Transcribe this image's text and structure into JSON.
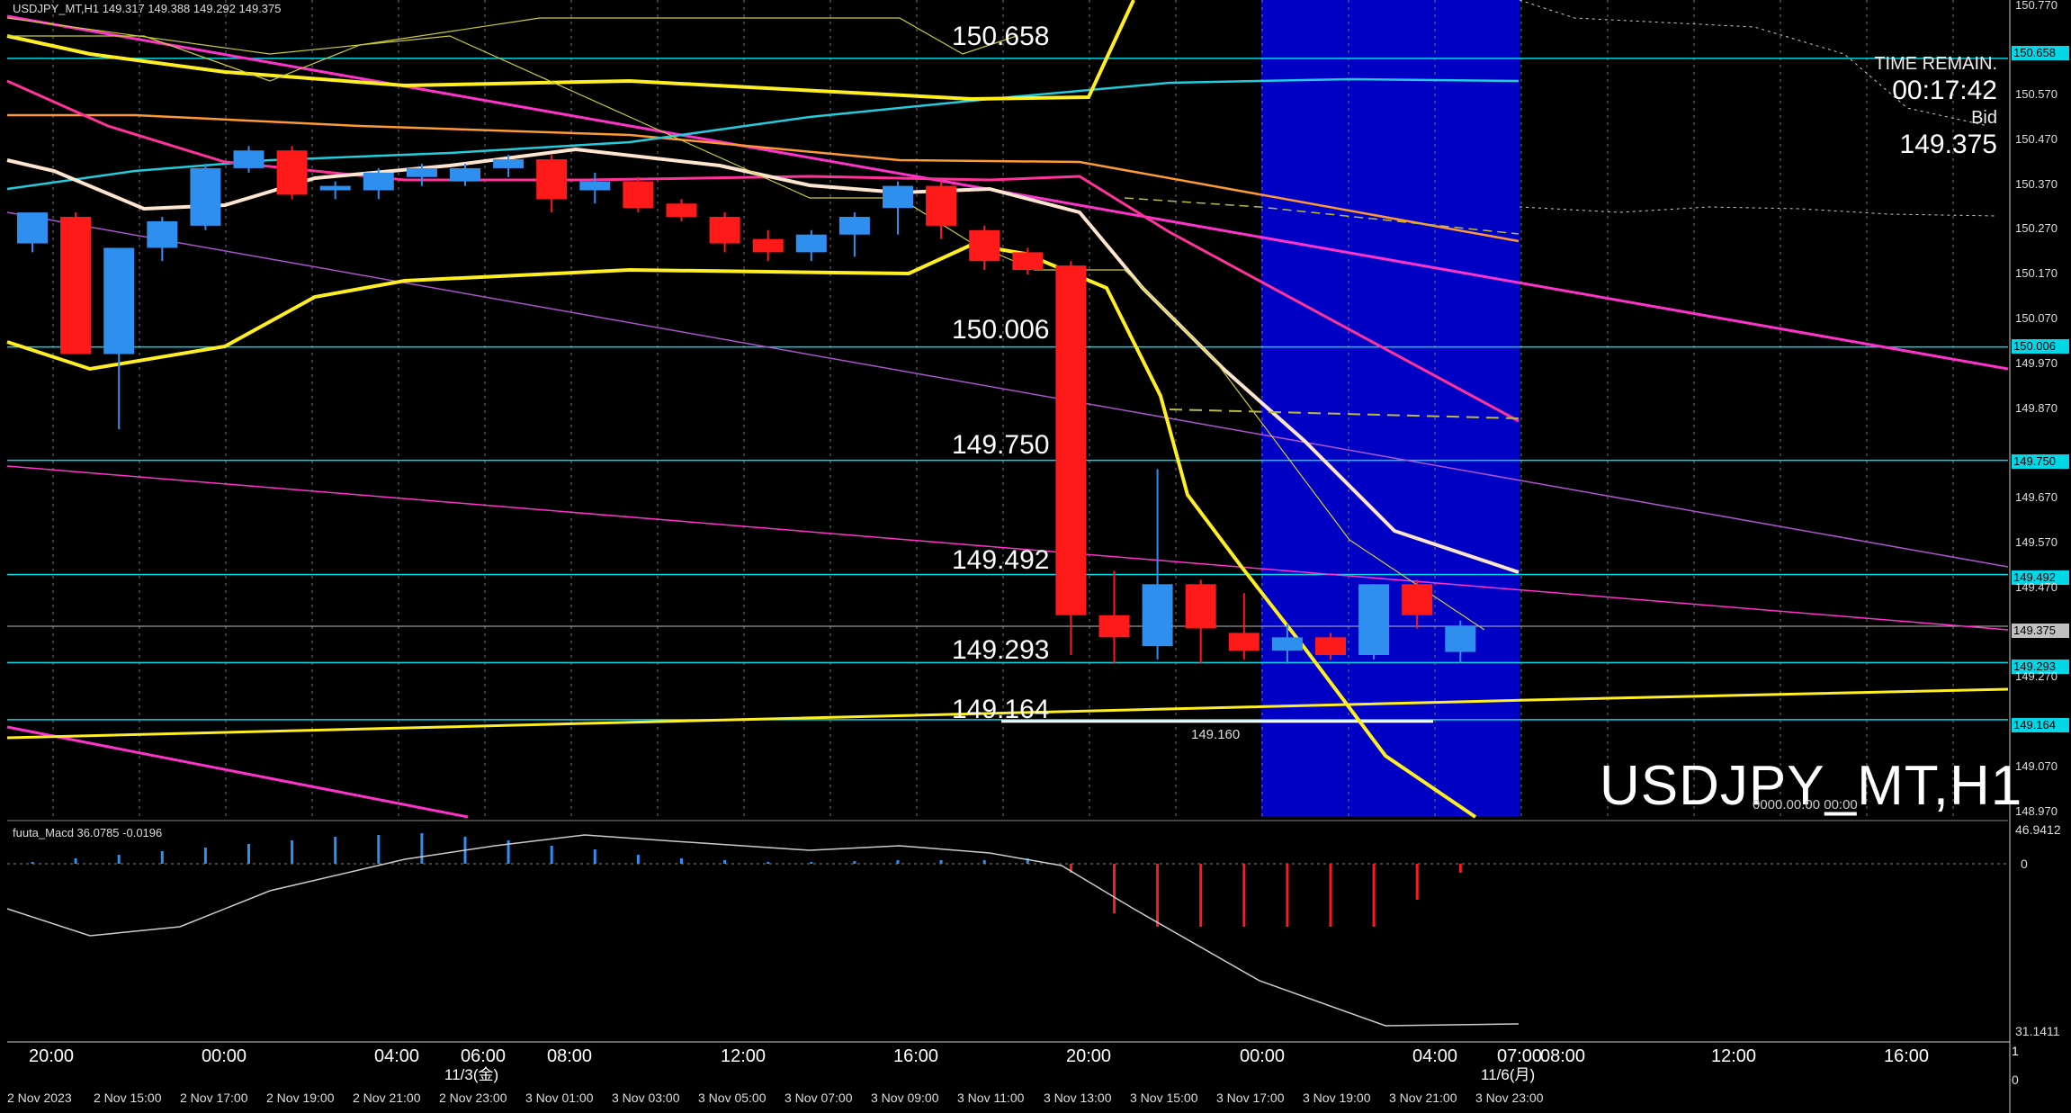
{
  "header": {
    "symbol_info": "USDJPY_MT,H1  149.317 149.388 149.292 149.375"
  },
  "watermark": {
    "symbol_tf": "USDJPY_MT,H1",
    "small_text": "0000.00.00 00:00"
  },
  "timer": {
    "label": "TIME REMAIN.",
    "value": "00:17:42",
    "bid_label": "Bid",
    "bid_value": "149.375"
  },
  "price_axis": {
    "ticks": [
      "150.770",
      "150.570",
      "150.470",
      "150.370",
      "150.270",
      "150.170",
      "150.070",
      "149.970",
      "149.870",
      "149.670",
      "149.570",
      "149.470",
      "149.270",
      "149.070",
      "148.970"
    ],
    "ymax": 150.79,
    "ymin": 148.94
  },
  "levels": [
    {
      "label": "150.658",
      "price": 150.658,
      "tag": "150.658"
    },
    {
      "label": "150.006",
      "price": 150.006,
      "tag": "150.006"
    },
    {
      "label": "149.750",
      "price": 149.75,
      "tag": "149.750"
    },
    {
      "label": "149.492",
      "price": 149.492,
      "tag": "149.492"
    },
    {
      "label": "149.293",
      "price": 149.293,
      "tag": "149.293"
    },
    {
      "label": "149.164",
      "price": 149.164,
      "tag": "149.164"
    }
  ],
  "current_price": {
    "price": 149.375,
    "tag": "149.375"
  },
  "low_marker": {
    "label": "149.160",
    "price": 149.16
  },
  "chart_data": {
    "type": "candlestick",
    "candles": [
      {
        "o": 150.24,
        "h": 150.3,
        "c": 150.31,
        "l": 150.22
      },
      {
        "o": 150.3,
        "h": 150.31,
        "c": 149.99,
        "l": 149.99
      },
      {
        "o": 149.99,
        "h": 150.23,
        "c": 150.23,
        "l": 149.82
      },
      {
        "o": 150.23,
        "h": 150.3,
        "c": 150.29,
        "l": 150.2
      },
      {
        "o": 150.28,
        "h": 150.42,
        "c": 150.41,
        "l": 150.27
      },
      {
        "o": 150.41,
        "h": 150.46,
        "c": 150.45,
        "l": 150.4
      },
      {
        "o": 150.45,
        "h": 150.46,
        "c": 150.35,
        "l": 150.34
      },
      {
        "o": 150.36,
        "h": 150.38,
        "c": 150.37,
        "l": 150.34
      },
      {
        "o": 150.36,
        "h": 150.41,
        "c": 150.4,
        "l": 150.34
      },
      {
        "o": 150.39,
        "h": 150.42,
        "c": 150.41,
        "l": 150.37
      },
      {
        "o": 150.38,
        "h": 150.42,
        "c": 150.41,
        "l": 150.37
      },
      {
        "o": 150.41,
        "h": 150.44,
        "c": 150.43,
        "l": 150.39
      },
      {
        "o": 150.43,
        "h": 150.44,
        "c": 150.34,
        "l": 150.31
      },
      {
        "o": 150.36,
        "h": 150.4,
        "c": 150.38,
        "l": 150.33
      },
      {
        "o": 150.38,
        "h": 150.39,
        "c": 150.32,
        "l": 150.31
      },
      {
        "o": 150.33,
        "h": 150.34,
        "c": 150.3,
        "l": 150.29
      },
      {
        "o": 150.3,
        "h": 150.31,
        "c": 150.24,
        "l": 150.22
      },
      {
        "o": 150.25,
        "h": 150.27,
        "c": 150.22,
        "l": 150.2
      },
      {
        "o": 150.22,
        "h": 150.27,
        "c": 150.26,
        "l": 150.2
      },
      {
        "o": 150.26,
        "h": 150.31,
        "c": 150.3,
        "l": 150.21
      },
      {
        "o": 150.32,
        "h": 150.38,
        "c": 150.37,
        "l": 150.26
      },
      {
        "o": 150.37,
        "h": 150.38,
        "c": 150.28,
        "l": 150.25
      },
      {
        "o": 150.27,
        "h": 150.28,
        "c": 150.2,
        "l": 150.18
      },
      {
        "o": 150.22,
        "h": 150.23,
        "c": 150.18,
        "l": 150.17
      },
      {
        "o": 150.19,
        "h": 150.2,
        "c": 149.4,
        "l": 149.31
      },
      {
        "o": 149.4,
        "h": 149.5,
        "c": 149.35,
        "l": 149.29
      },
      {
        "o": 149.33,
        "h": 149.73,
        "c": 149.47,
        "l": 149.3
      },
      {
        "o": 149.47,
        "h": 149.48,
        "c": 149.37,
        "l": 149.29
      },
      {
        "o": 149.36,
        "h": 149.45,
        "c": 149.32,
        "l": 149.3
      },
      {
        "o": 149.32,
        "h": 149.38,
        "c": 149.35,
        "l": 149.29
      },
      {
        "o": 149.35,
        "h": 149.36,
        "c": 149.31,
        "l": 149.3
      },
      {
        "o": 149.31,
        "h": 149.47,
        "c": 149.47,
        "l": 149.3
      },
      {
        "o": 149.47,
        "h": 149.48,
        "c": 149.4,
        "l": 149.37
      },
      {
        "o": 149.317,
        "h": 149.388,
        "c": 149.375,
        "l": 149.292
      }
    ]
  },
  "macd": {
    "header": "fuuta_Macd 36.0785  -0.0196",
    "axis_top": "46.9412",
    "axis_zero": "0",
    "axis_bottom": "31.1411"
  },
  "time_axis": {
    "labels": [
      "20:00",
      "00:00",
      "04:00",
      "06:00",
      "08:00",
      "12:00",
      "16:00",
      "20:00",
      "00:00",
      "04:00",
      "07:00",
      "08:00",
      "12:00",
      "16:00"
    ],
    "day_labels": [
      "11/3(金)",
      "11/6(月)"
    ],
    "right_mark": "1"
  },
  "date_axis": {
    "labels": [
      "2 Nov 2023",
      "2 Nov 15:00",
      "2 Nov 17:00",
      "2 Nov 19:00",
      "2 Nov 21:00",
      "2 Nov 23:00",
      "3 Nov 01:00",
      "3 Nov 03:00",
      "3 Nov 05:00",
      "3 Nov 07:00",
      "3 Nov 09:00",
      "3 Nov 11:00",
      "3 Nov 13:00",
      "3 Nov 15:00",
      "3 Nov 17:00",
      "3 Nov 19:00",
      "3 Nov 21:00",
      "3 Nov 23:00"
    ],
    "right_mark": "0"
  },
  "colors": {
    "bull": "#2f8fef",
    "bear": "#ff1a1a",
    "level_line": "#00d8e8",
    "highlight_zone": "#0000e0",
    "yellow": "#ffee22",
    "magenta": "#ff33cc",
    "ma_white": "#ffe4d0",
    "ma_pink": "#ff3399",
    "orange": "#ff9933"
  }
}
